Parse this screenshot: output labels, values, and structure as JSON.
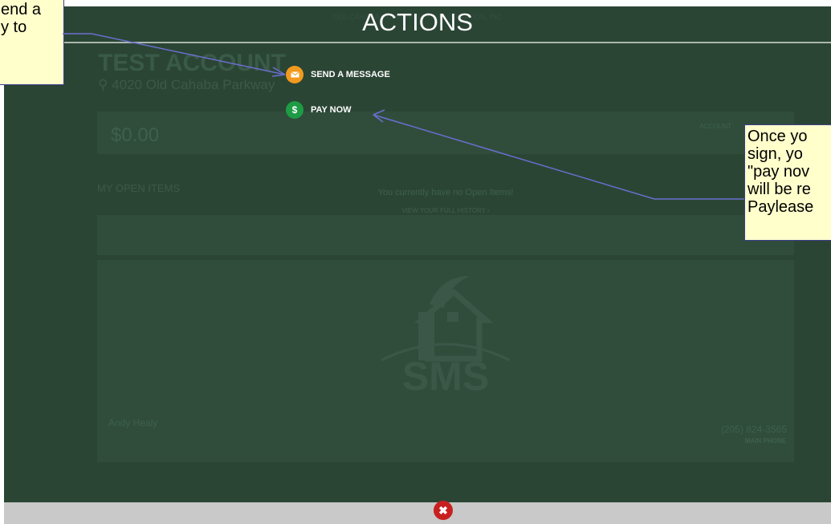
{
  "modal": {
    "org_name": "OLD CAHABA HOMEOWNERS ASSOCIATION, INC",
    "title": "ACTIONS",
    "actions": [
      {
        "label": "SEND A MESSAGE",
        "icon": "envelope-icon",
        "color": "#f39a1e"
      },
      {
        "label": "PAY NOW",
        "icon": "dollar-icon",
        "icon_glyph": "$",
        "color": "#1e9b45"
      }
    ],
    "close_icon": "close-icon",
    "close_color": "#c7201f"
  },
  "account": {
    "name": "TEST ACCOUNT",
    "address": "4020 Old Cahaba Parkway",
    "balance": "$0.00",
    "account_label": "ACCOUNT",
    "open_items_title": "MY OPEN ITEMS",
    "no_items_text": "You currently have no Open Items!",
    "history_link": "VIEW YOUR FULL HISTORY ›",
    "logo_text": "SMS",
    "contact_name": "Andy Healy",
    "phone": "(205) 824-3565",
    "phone_label": "MAIN PHONE"
  },
  "callouts": [
    {
      "text": "end a\ny to",
      "color": "#ffffcc"
    },
    {
      "text": "Once yo\nsign, yo\n\"pay nov\nwill be re\nPaylease",
      "color": "#ffffcc"
    }
  ]
}
